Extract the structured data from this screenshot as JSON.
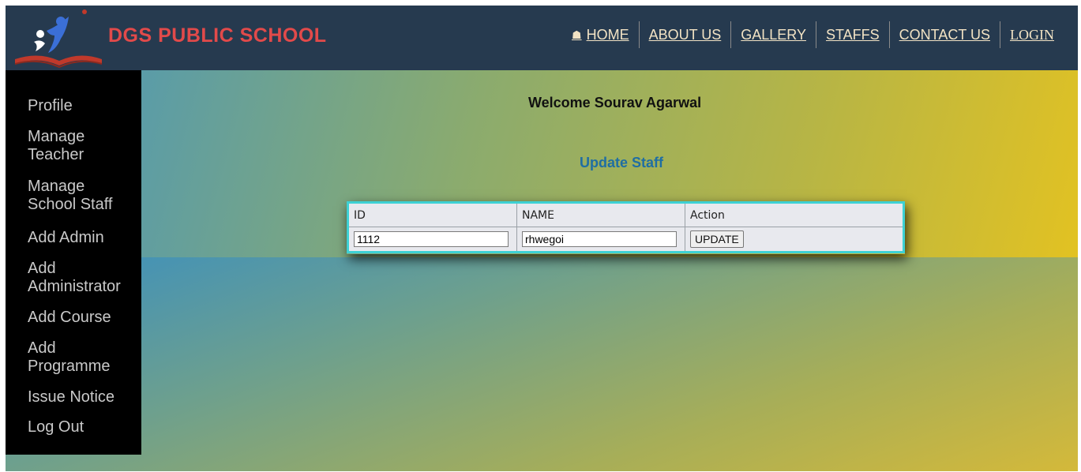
{
  "header": {
    "brand": "DGS PUBLIC SCHOOL",
    "nav": [
      {
        "label": "HOME",
        "icon": "home-icon"
      },
      {
        "label": "ABOUT US"
      },
      {
        "label": "GALLERY"
      },
      {
        "label": "STAFFS"
      },
      {
        "label": "CONTACT US"
      },
      {
        "label": "LOGIN"
      }
    ]
  },
  "sidebar": {
    "items": [
      {
        "label": "Profile"
      },
      {
        "label": "Manage Teacher"
      },
      {
        "label": "Manage School Staff"
      },
      {
        "label": "Add Admin"
      },
      {
        "label": "Add Administrator"
      },
      {
        "label": "Add Course"
      },
      {
        "label": "Add Programme"
      },
      {
        "label": "Issue Notice"
      },
      {
        "label": "Log Out"
      }
    ]
  },
  "main": {
    "welcome": "Welcome Sourav Agarwal",
    "form_title": "Update Staff",
    "table": {
      "headers": [
        "ID",
        "NAME",
        "Action"
      ],
      "row": {
        "id_value": "1112",
        "name_value": "rhwegoi",
        "action_label": "UPDATE"
      }
    }
  },
  "colors": {
    "header_bg": "#263a4f",
    "brand": "#e24a4a",
    "nav_text": "#f2e3c4",
    "sidebar_bg": "#000000",
    "sidebar_text": "#c9c9c9",
    "form_title": "#1f6ea3",
    "table_border": "#3ed1d4"
  }
}
